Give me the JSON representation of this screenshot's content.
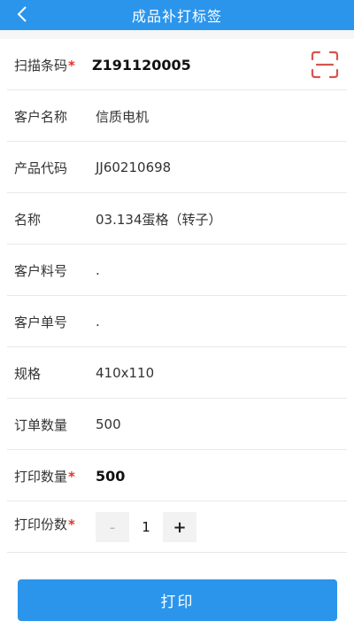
{
  "header": {
    "title": "成品补打标签",
    "back_icon": "chevron-left-icon"
  },
  "fields": {
    "barcode": {
      "label": "扫描条码",
      "required": "*",
      "value": "Z191120005",
      "scan_icon": "scan-frame-icon"
    },
    "customer_name": {
      "label": "客户名称",
      "value": "信质电机"
    },
    "product_code": {
      "label": "产品代码",
      "value": "JJ60210698"
    },
    "name": {
      "label": "名称",
      "value": "03.134蛋格（转子）"
    },
    "customer_material_no": {
      "label": "客户料号",
      "value": "."
    },
    "customer_order_no": {
      "label": "客户单号",
      "value": "."
    },
    "spec": {
      "label": "规格",
      "value": "410x110"
    },
    "order_qty": {
      "label": "订单数量",
      "value": "500"
    },
    "print_qty": {
      "label": "打印数量",
      "required": "*",
      "value": "500"
    },
    "print_copies": {
      "label": "打印份数",
      "required": "*",
      "value": "1",
      "minus": "-",
      "plus": "+"
    }
  },
  "actions": {
    "print_label": "打印"
  },
  "colors": {
    "primary": "#2b95ec",
    "required": "#e0322a",
    "scan_icon": "#d9534f"
  }
}
